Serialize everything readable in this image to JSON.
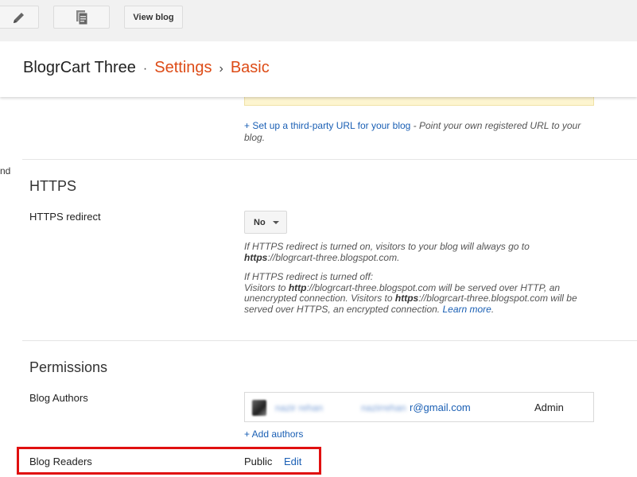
{
  "toolbar": {
    "view_blog_label": "View blog"
  },
  "breadcrumb": {
    "blog_name": "BlogrCart Three",
    "sep1": "·",
    "section": "Settings",
    "sep2": "›",
    "page": "Basic"
  },
  "publishing": {
    "third_party_link": "+ Set up a third-party URL for your blog",
    "third_party_desc": " - Point your own registered URL to your blog.",
    "edge_text": "nd"
  },
  "https": {
    "title": "HTTPS",
    "redirect_label": "HTTPS redirect",
    "redirect_value": "No",
    "info_on_1": "If HTTPS redirect is turned on, visitors to your blog will always go to",
    "info_on_scheme": "https",
    "info_on_url": "://blogrcart-three.blogspot.com.",
    "info_off_1": "If HTTPS redirect is turned off:",
    "info_off_2": "Visitors to ",
    "info_off_http": "http",
    "info_off_3": "://blogrcart-three.blogspot.com will be served over HTTP, an unencrypted connection. Visitors to ",
    "info_off_https": "https",
    "info_off_4": "://blogrcart-three.blogspot.com will be served over HTTPS, an encrypted connection. ",
    "learn_more": "Learn more",
    "period": "."
  },
  "permissions": {
    "title": "Permissions",
    "authors_label": "Blog Authors",
    "author": {
      "name_blurred": "nazir rehan",
      "email_prefix_blurred": "nazirrehan",
      "email_suffix": "r@gmail.com",
      "role": "Admin"
    },
    "add_authors": "+ Add authors",
    "readers_label": "Blog Readers",
    "readers_value": "Public",
    "readers_edit": "Edit"
  },
  "colors": {
    "accent_orange": "#dd4b16",
    "link_blue": "#1a5fb4",
    "highlight_red": "#e01010"
  },
  "icons": [
    "pencil-icon",
    "pages-icon",
    "caret-down-icon"
  ]
}
